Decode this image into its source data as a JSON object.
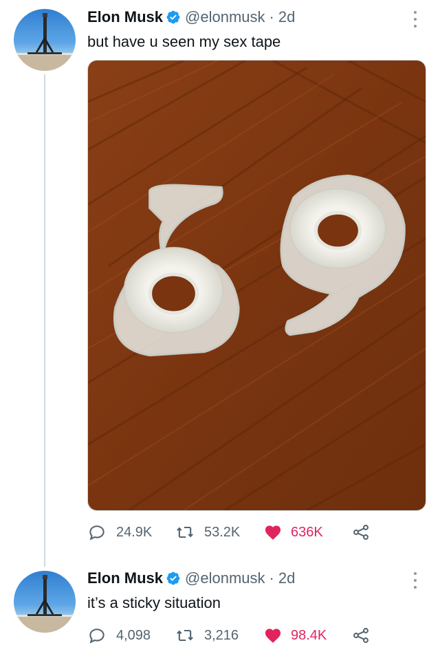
{
  "tweets": [
    {
      "author_name": "Elon Musk",
      "handle": "@elonmusk",
      "separator": "·",
      "time": "2d",
      "text": "but have u seen my sex tape",
      "media_description_icon": "photo-of-two-tape-dispensers-forming-69",
      "stats": {
        "replies": "24.9K",
        "retweets": "53.2K",
        "likes": "636K"
      }
    },
    {
      "author_name": "Elon Musk",
      "handle": "@elonmusk",
      "separator": "·",
      "time": "2d",
      "text": "it’s a sticky situation",
      "stats": {
        "replies": "4,098",
        "retweets": "3,216",
        "likes": "98.4K"
      }
    }
  ],
  "colors": {
    "verified": "#1d9bf0",
    "like": "#e0245e",
    "secondary_text": "#536471",
    "thread_line": "#cfd9de"
  },
  "icons": [
    "reply-icon",
    "retweet-icon",
    "like-heart-icon",
    "share-icon",
    "verified-badge-icon",
    "more-options-icon"
  ]
}
